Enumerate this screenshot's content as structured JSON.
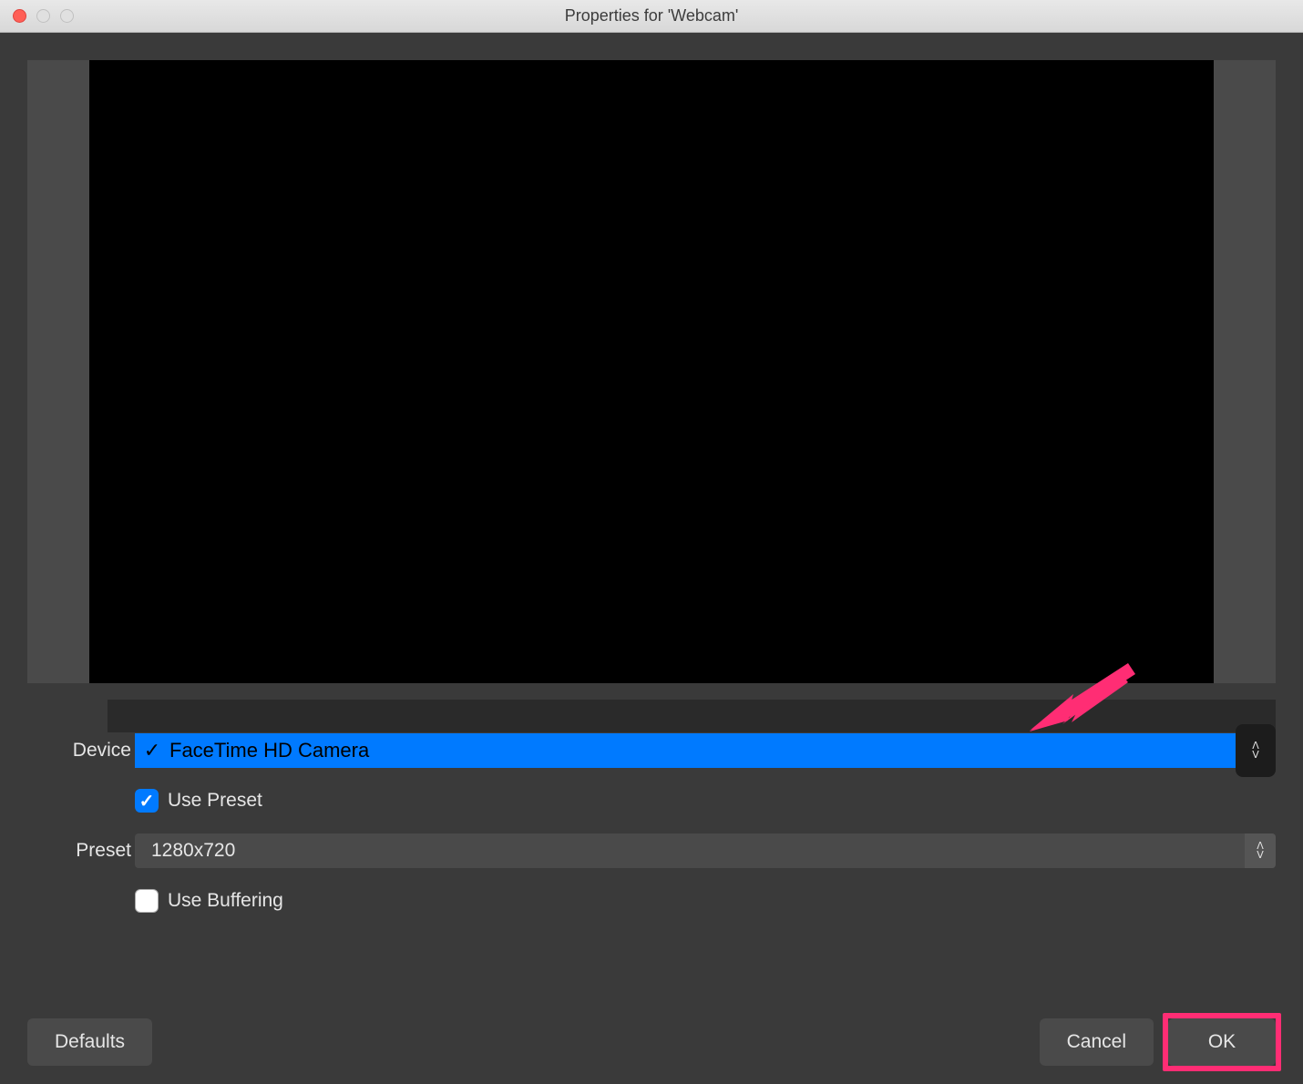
{
  "window": {
    "title": "Properties for 'Webcam'"
  },
  "form": {
    "device_label": "Device",
    "device_value": "FaceTime HD Camera",
    "use_preset_label": "Use Preset",
    "use_preset_checked": true,
    "preset_label": "Preset",
    "preset_value": "1280x720",
    "use_buffering_label": "Use Buffering",
    "use_buffering_checked": false
  },
  "buttons": {
    "defaults": "Defaults",
    "cancel": "Cancel",
    "ok": "OK"
  },
  "colors": {
    "accent": "#007aff",
    "annotation": "#ff2d74"
  }
}
